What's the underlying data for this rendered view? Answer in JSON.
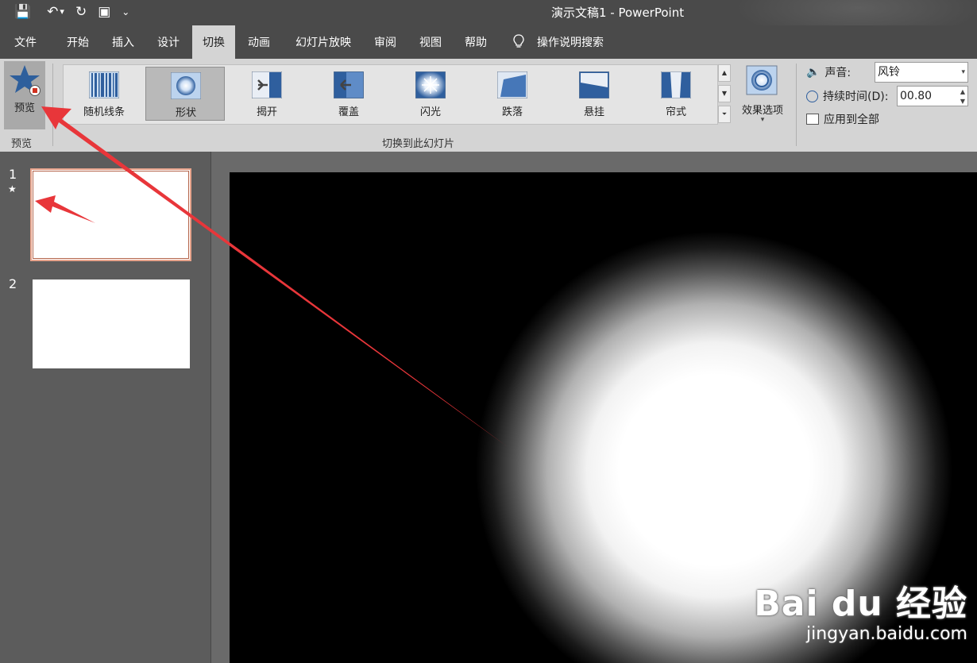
{
  "app": {
    "title": "演示文稿1  -  PowerPoint"
  },
  "qat": {
    "items": [
      {
        "name": "save-icon",
        "glyph": "💾"
      },
      {
        "name": "undo-icon",
        "glyph": "↶"
      },
      {
        "name": "undo-dropdown-icon",
        "glyph": "▾"
      },
      {
        "name": "redo-icon",
        "glyph": "↻"
      },
      {
        "name": "start-from-beginning-icon",
        "glyph": "▣"
      },
      {
        "name": "customize-qat-icon",
        "glyph": "⌄"
      }
    ]
  },
  "tabs": [
    "文件",
    "开始",
    "插入",
    "设计",
    "切换",
    "动画",
    "幻灯片放映",
    "审阅",
    "视图",
    "帮助",
    "操作说明搜索"
  ],
  "active_tab": "切换",
  "ribbon": {
    "preview_button": "预览",
    "preview_group": "预览",
    "transitions": [
      "随机线条",
      "形状",
      "揭开",
      "覆盖",
      "闪光",
      "跌落",
      "悬挂",
      "帘式"
    ],
    "selected_transition": "形状",
    "transition_group": "切换到此幻灯片",
    "effect_options": "效果选项",
    "sound_label": "声音:",
    "sound_value": "风铃",
    "duration_label": "持续时间(D):",
    "duration_value": "00.80",
    "apply_all": "应用到全部"
  },
  "slides": [
    {
      "number": "1",
      "has_transition": true,
      "marker": "★"
    },
    {
      "number": "2",
      "has_transition": false,
      "marker": ""
    }
  ],
  "watermark": {
    "brand": "Bai du 经验",
    "url": "jingyan.baidu.com"
  },
  "colors": {
    "titlebar": "#4a4a4a",
    "ribbon": "#d4d4d4",
    "annotation_arrow": "#e8363a",
    "selected_thumb_border": "#e8a48c"
  }
}
